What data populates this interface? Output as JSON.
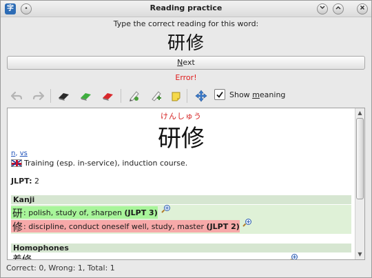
{
  "window": {
    "title": "Reading practice"
  },
  "quiz": {
    "prompt": "Type the correct reading for this word:",
    "word": "研修",
    "next_label_accel": "N",
    "next_label_rest": "ext",
    "error": "Error!"
  },
  "toolbar": {
    "show_meaning_label_pre": "Show ",
    "show_meaning_label_accel": "m",
    "show_meaning_label_post": "eaning",
    "show_meaning_checked": true
  },
  "entry": {
    "reading": "けんしゅう",
    "word": "研修",
    "pos": [
      "n",
      "vs"
    ],
    "pos_sep": ",",
    "gloss": "Training (esp. in-service), induction course.",
    "jlpt_label": "JLPT:",
    "jlpt_value": "2",
    "kanji_heading": "Kanji",
    "kanji": [
      {
        "char": "研",
        "meaning": ": polish, study of, sharpen",
        "jlpt": "(JLPT 3)",
        "status": "green"
      },
      {
        "char": "修",
        "meaning": ": discipline, conduct oneself well, study, master",
        "jlpt": "(JLPT 2)",
        "status": "red"
      }
    ],
    "homophones_heading": "Homophones",
    "homophone_partial": "着修"
  },
  "status": {
    "text": "Correct: 0, Wrong: 1, Total: 1"
  },
  "colors": {
    "error": "#e01b1b",
    "reading": "#d42020",
    "kanji_known": "#a8f59a",
    "kanji_unknown": "#f7a9a9",
    "section_bg": "#d6e6d1"
  }
}
